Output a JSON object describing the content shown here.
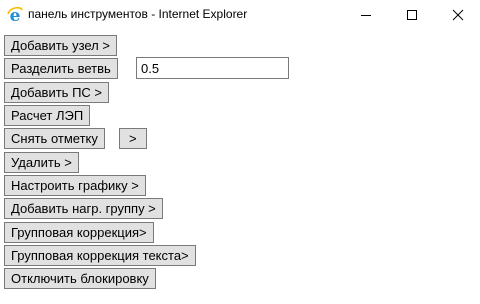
{
  "window": {
    "title": "панель инструментов - Internet Explorer",
    "icons": {
      "app": "internet-explorer-icon",
      "minimize": "minimize-icon",
      "maximize": "maximize-icon",
      "close": "close-icon"
    },
    "accent": "#1e8fd6"
  },
  "toolbar": {
    "add_node": "Добавить узел >",
    "split_branch": "Разделить ветвь",
    "split_value": "0.5",
    "add_substation": "Добавить ПС >",
    "line_calc": "Расчет ЛЭП",
    "unmark": "Снять отметку",
    "unmark_more": ">",
    "delete": "Удалить >",
    "configure_graphics": "Настроить графику >",
    "add_load_group": "Добавить нагр. группу >",
    "group_correction": "Групповая коррекция>",
    "group_text_correction": "Групповая коррекция текста>",
    "disable_lock": "Отключить блокировку"
  }
}
